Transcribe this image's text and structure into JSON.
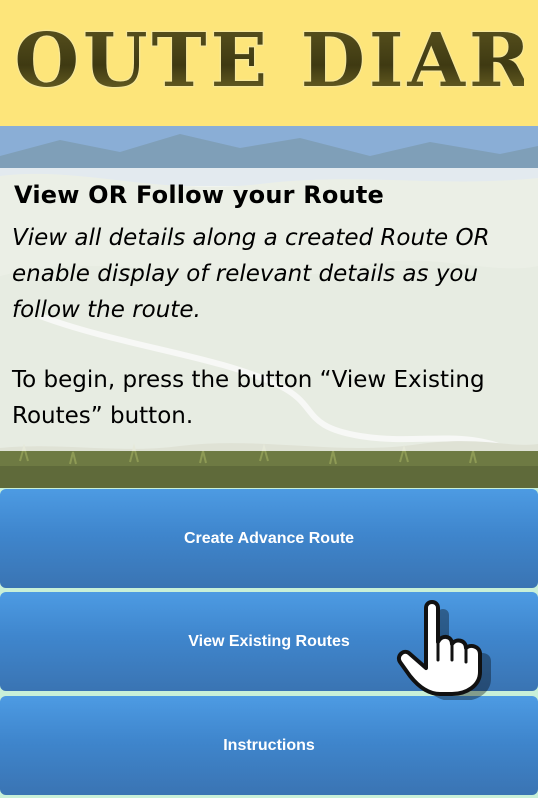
{
  "header": {
    "logo_text": "ROUTE DIARY",
    "logo_alt": "Route Diary"
  },
  "info": {
    "title": "View OR Follow your Route",
    "description": "View all details along a created Route OR enable display of relevant details as you follow the route.",
    "instruction": "To begin, press the button “View Existing Routes” button."
  },
  "buttons": {
    "create_label": "Create Advance Route",
    "view_label": "View Existing Routes",
    "instructions_label": "Instructions"
  },
  "icons": {
    "pointer": "hand-pointer-icon"
  },
  "colors": {
    "header_bg": "#fde57a",
    "logo_fill": "#4a4418",
    "button_blue": "#3f86cd",
    "button_text": "#ffffff"
  }
}
